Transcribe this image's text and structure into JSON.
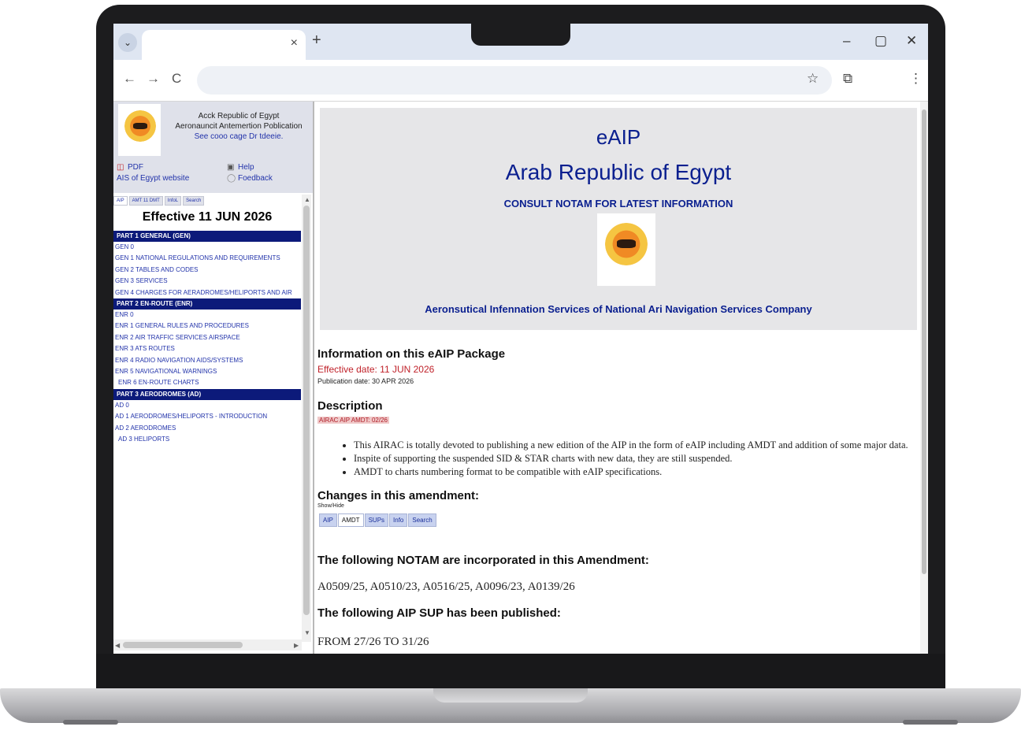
{
  "browser": {
    "tab_title": "",
    "tab_close": "×",
    "new_tab": "+",
    "minimize": "–",
    "restore": "▢",
    "close": "✕",
    "back": "←",
    "forward": "→",
    "reload": "C",
    "menu_chevron": "⌄",
    "address": "",
    "star": "☆",
    "extensions": "⧉",
    "more": "⋮"
  },
  "left": {
    "header_line1": "Acck Republic of Egypt",
    "header_line2": "Aeronauncit Antemertion Poblication",
    "header_line3": "See cooo cage Dr tdeeie.",
    "pdf_link": "PDF",
    "website_link": "AIS of Egypt website",
    "help_link": "Help",
    "feedback_link": "Foedback",
    "tabs": [
      "AIP",
      "AMT 11 DMT",
      "InfoL",
      "Search"
    ],
    "effective": "Effective 11 JUN 2026",
    "sections": [
      {
        "title": "PART 1 GENERAL (GEN)",
        "items": [
          "GEN 0",
          "GEN 1 NATIONAL REGULATIONS AND REQUIREMENTS",
          "GEN 2 TABLES AND CODES",
          "GEN 3 SERVICES",
          "GEN 4 CHARGES FOR AERADROMES/HELIPORTS AND AIR"
        ]
      },
      {
        "title": "PART 2 EN-ROUTE (ENR)",
        "items": [
          "ENR 0",
          "ENR 1 GENERAL RULES AND PROCEDURES",
          "ENR 2 AIR TRAFFIC SERVICES AIRSPACE",
          "ENR 3 ATS ROUTES",
          "ENR 4 RADIO NAVIGATION AIDS/SYSTEMS",
          "ENR 5 NAVIGATIONAL WARNINGS",
          "ENR 6 EN-ROUTE CHARTS"
        ]
      },
      {
        "title": "PART 3 AERODROMES (AD)",
        "items": [
          "AD 0",
          "AD 1 AERODROMES/HELIPORTS - INTRODUCTION",
          "AD 2 AERODROMES",
          "AD 3 HELIPORTS"
        ]
      }
    ]
  },
  "banner": {
    "title": "eAIP",
    "country": "Arab Republic of Egypt",
    "consult": "CONSULT NOTAM FOR LATEST INFORMATION",
    "organisation": "Aeronsutical Infennation Services of National Ari Navigation Services Company"
  },
  "main": {
    "info_heading": "Information on this eAIP Package",
    "effective_line": "Effective date: 11 JUN 2026",
    "publication_line": "Publication date: 30 APR 2026",
    "description_heading": "Description",
    "description_tag": "AIRAC AIP AMDT: 02/26",
    "bullets": [
      "This AIRAC is totally devoted to publishing a new edition of the AIP in the form of eAIP including AMDT and addition of some major data.",
      "Inspite of supporting the suspended SID & STAR charts with new data, they are still suspended.",
      "AMDT to charts numbering format to be compatible with eAIP specifications."
    ],
    "changes_heading": "Changes in this amendment:",
    "changes_small": "Show/Hide",
    "changes_tabs": [
      "AIP",
      "AMDT",
      "SUPs",
      "Info",
      "Search"
    ],
    "notam_heading": "The following NOTAM are incorporated in this Amendment:",
    "notam_list": "A0509/25, A0510/23, A0516/25, A0096/23, A0139/26",
    "sup_heading": "The following AIP SUP has been published:",
    "sup_list": "FROM 27/26 TO 31/26"
  }
}
